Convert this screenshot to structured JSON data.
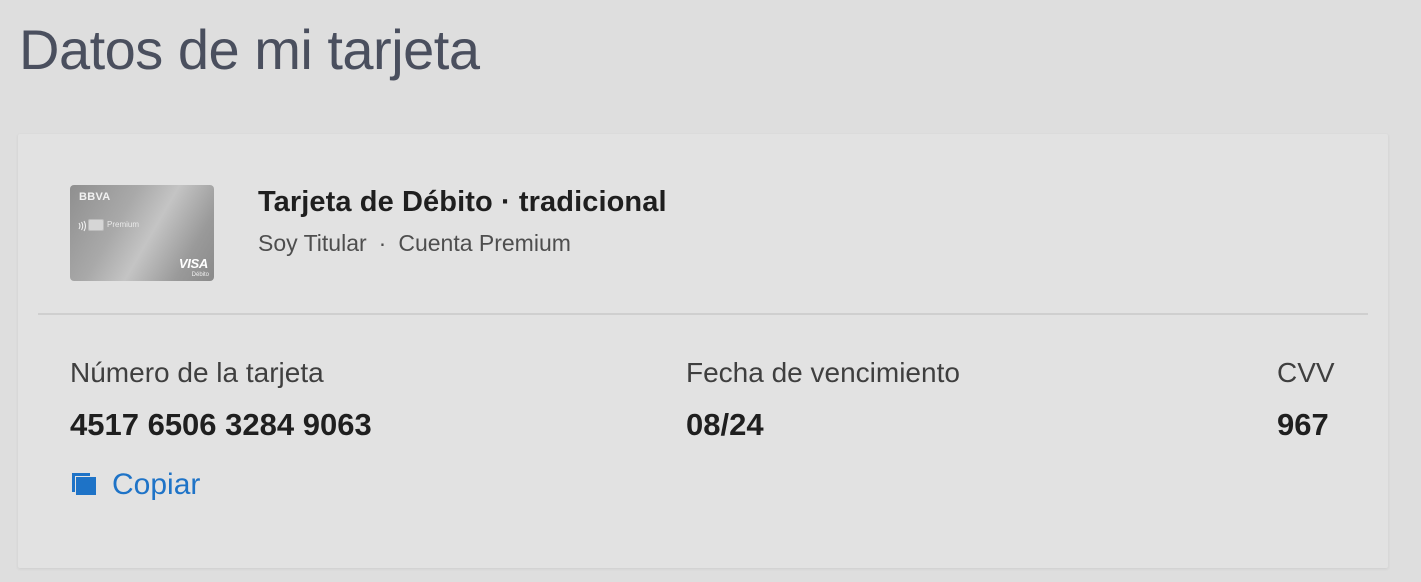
{
  "header": {
    "title": "Datos de mi tarjeta"
  },
  "card": {
    "image": {
      "brand": "BBVA",
      "tier": "Premium",
      "network": "VISA",
      "network_sub": "Débito"
    },
    "title": "Tarjeta de Débito · tradicional",
    "subtitle": {
      "role": "Soy Titular",
      "separator": "·",
      "account": "Cuenta Premium"
    }
  },
  "fields": {
    "number": {
      "label": "Número de la tarjeta",
      "value": "4517 6506 3284 9063"
    },
    "expiry": {
      "label": "Fecha de vencimiento",
      "value": "08/24"
    },
    "cvv": {
      "label": "CVV",
      "value": "967"
    }
  },
  "actions": {
    "copy_label": "Copiar",
    "copy_icon": "copy-icon"
  },
  "colors": {
    "background": "#dedede",
    "panel": "#e2e2e2",
    "accent": "#1e73c7",
    "title": "#4a4f5e"
  }
}
